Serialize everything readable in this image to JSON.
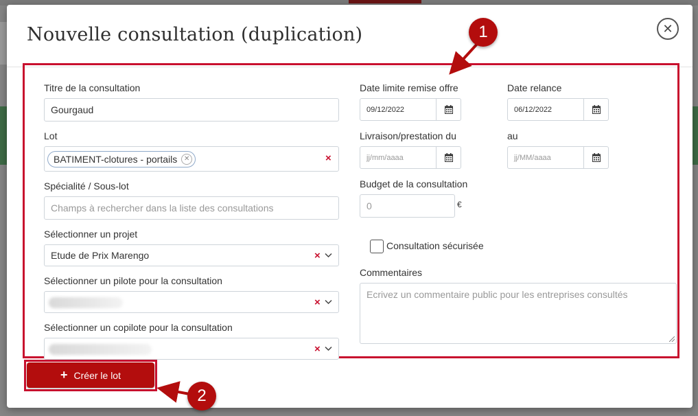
{
  "modal": {
    "title": "Nouvelle consultation (duplication)",
    "close_icon": "close-icon"
  },
  "form": {
    "titre": {
      "label": "Titre de la consultation",
      "value": "Gourgaud"
    },
    "lot": {
      "label": "Lot",
      "tag": "BATIMENT-clotures - portails"
    },
    "specialite": {
      "label": "Spécialité / Sous-lot",
      "placeholder": "Champs à rechercher dans la liste des consultations"
    },
    "projet": {
      "label": "Sélectionner un projet",
      "value": "Etude de Prix Marengo"
    },
    "pilote": {
      "label": "Sélectionner un pilote pour la consultation"
    },
    "copilote": {
      "label": "Sélectionner un copilote pour la consultation"
    },
    "date_limite": {
      "label": "Date limite remise offre",
      "value": "09/12/2022"
    },
    "date_relance": {
      "label": "Date relance",
      "value": "06/12/2022"
    },
    "livraison_du": {
      "label": "Livraison/prestation du",
      "placeholder": "jj/mm/aaaa"
    },
    "livraison_au": {
      "label": "au",
      "placeholder": "jj/MM/aaaa"
    },
    "budget": {
      "label": "Budget de la consultation",
      "placeholder": "0",
      "currency": "€"
    },
    "securisee": {
      "label": "Consultation sécurisée",
      "checked": false
    },
    "commentaires": {
      "label": "Commentaires",
      "placeholder": "Ecrivez un commentaire public pour les entreprises consultés"
    }
  },
  "actions": {
    "create_label": "Créer le lot"
  },
  "callouts": [
    "1",
    "2"
  ],
  "colors": {
    "accent": "#c8102e",
    "button": "#b30d0d"
  }
}
